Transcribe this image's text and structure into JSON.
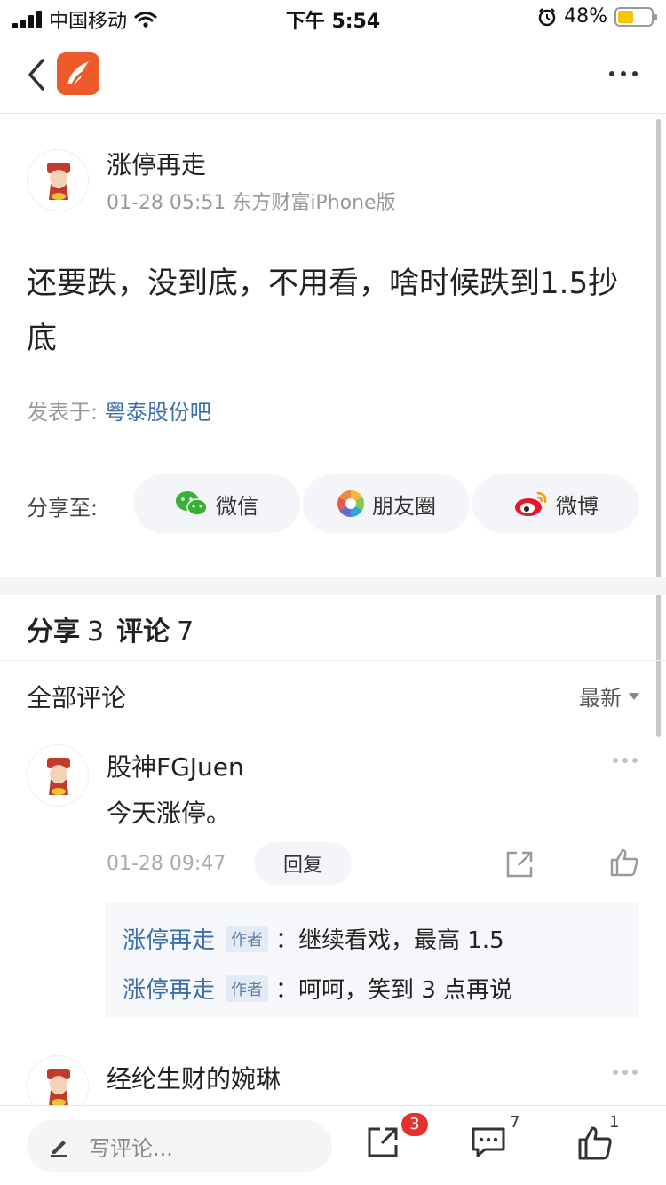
{
  "status_bar": {
    "carrier": "中国移动",
    "time": "下午 5:54",
    "battery": "48%",
    "battery_level": 0.48
  },
  "post": {
    "author": "涨停再走",
    "meta": "01-28 05:51 东方财富iPhone版",
    "content": "还要跌，没到底，不用看，啥时候跌到1.5抄底",
    "forum_prefix": "发表于: ",
    "forum_name": "粤泰股份吧"
  },
  "share": {
    "label": "分享至:",
    "buttons": [
      {
        "label": "微信",
        "icon": "wechat-icon"
      },
      {
        "label": "朋友圈",
        "icon": "moments-icon"
      },
      {
        "label": "微博",
        "icon": "weibo-icon"
      }
    ]
  },
  "counts": {
    "share_label": "分享",
    "share_count": "3",
    "comment_label": "评论",
    "comment_count": "7"
  },
  "comments_header": {
    "title": "全部评论",
    "sort": "最新"
  },
  "comments": [
    {
      "name": "股神FGJuen",
      "text": "今天涨停。",
      "time": "01-28 09:47",
      "reply_label": "回复",
      "replies": [
        {
          "name": "涨停再走",
          "tag": "作者",
          "text": "：继续看戏，最高 1.5"
        },
        {
          "name": "涨停再走",
          "tag": "作者",
          "text": "：呵呵，笑到 3 点再说"
        }
      ]
    },
    {
      "name": "经纶生财的婉琳"
    }
  ],
  "bottom_bar": {
    "write_placeholder": "写评论...",
    "share_badge": "3",
    "comment_count": "7",
    "like_count": "1"
  }
}
